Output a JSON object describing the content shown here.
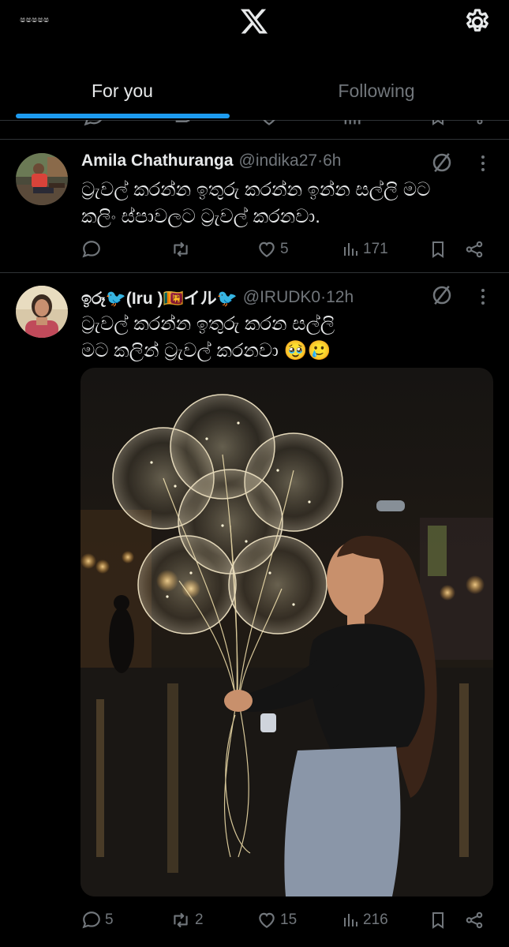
{
  "header": {
    "small_logo_icon": "logo-icon",
    "brand_icon": "x-logo-icon",
    "settings_icon": "gear-icon"
  },
  "tabs": [
    {
      "label": "For you",
      "active": true
    },
    {
      "label": "Following",
      "active": false
    }
  ],
  "colors": {
    "background": "#000000",
    "accent": "#1d9bf0",
    "text_primary": "#e7e9ea",
    "text_secondary": "#71767b",
    "divider": "#2f3336"
  },
  "tweets": [
    {
      "display_name": "Amila Chathuranga",
      "handle": "@indika27",
      "separator": " · ",
      "time": "6h",
      "text_lines": [
        "ට්‍රැවල් කරන්න ඉතුරු කරන්න ඉන්න සල්ලි මට",
        "කලිං ස්පාවලට ට්‍රැවල් කරනවා."
      ],
      "reply_count": "",
      "retweet_count": "",
      "like_count": "5",
      "view_count": "171"
    },
    {
      "display_name": "ඉරූ🐦(Iru )🇱🇰イル🐦",
      "handle": "@IRUDK0",
      "separator": " · ",
      "time": "12h",
      "text_lines": [
        "ට්‍රැවල් කරන්න ඉතුරු කරන සල්ලි",
        "මට කලින් ට්‍රැවල් කරනවා 🥹🥲"
      ],
      "reply_count": "5",
      "retweet_count": "2",
      "like_count": "15",
      "view_count": "216",
      "media": "photo-woman-with-glowing-balloons"
    }
  ]
}
